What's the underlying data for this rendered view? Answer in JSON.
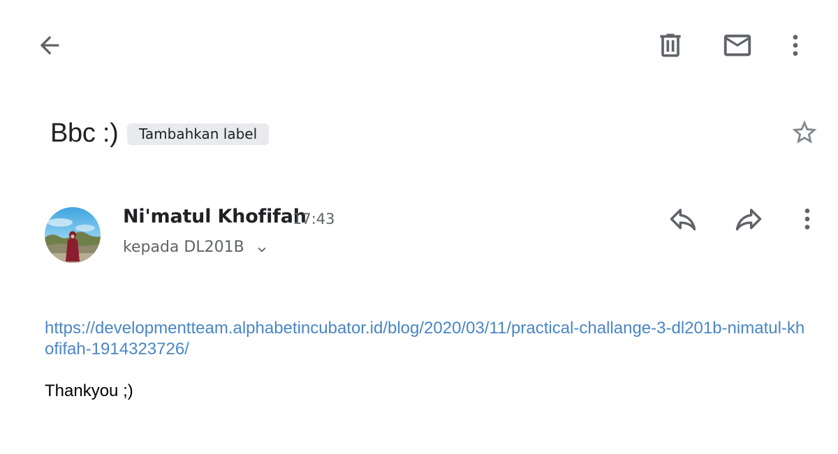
{
  "toolbar": {
    "back_icon": "arrow-back-icon",
    "delete_icon": "trash-icon",
    "mark_unread_icon": "mail-icon",
    "more_icon": "more-vert-icon"
  },
  "email": {
    "subject": "Bbc :)",
    "label_chip": "Tambahkan label",
    "starred": false,
    "sender": {
      "name": "Ni'matul Khofifah",
      "time": "17:43",
      "recipient": "kepada DL201B",
      "avatar_icon": "avatar-photo"
    },
    "body": {
      "link": "https://developmentteam.alphabetincubator.id/blog/2020/03/11/practical-challange-3-dl201b-nimatul-khofifah-1914323726/",
      "text": "Thankyou ;)"
    }
  },
  "colors": {
    "icon": "#5f6368",
    "link": "#4a86c5",
    "chip_bg": "#e8eaed",
    "text": "#202124",
    "muted": "#5f6368"
  }
}
